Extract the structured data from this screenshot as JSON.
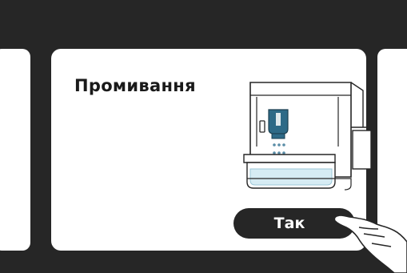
{
  "screen": {
    "title": "Промивання",
    "confirm_button_label": "Так",
    "illustration": "coffee-machine-rinsing-icon",
    "pointer": "tap-hand-icon"
  },
  "colors": {
    "background": "#262626",
    "card": "#ffffff",
    "accent": "#2e6a87",
    "water": "#d6ecf4",
    "button": "#262626",
    "button_text": "#ffffff"
  }
}
